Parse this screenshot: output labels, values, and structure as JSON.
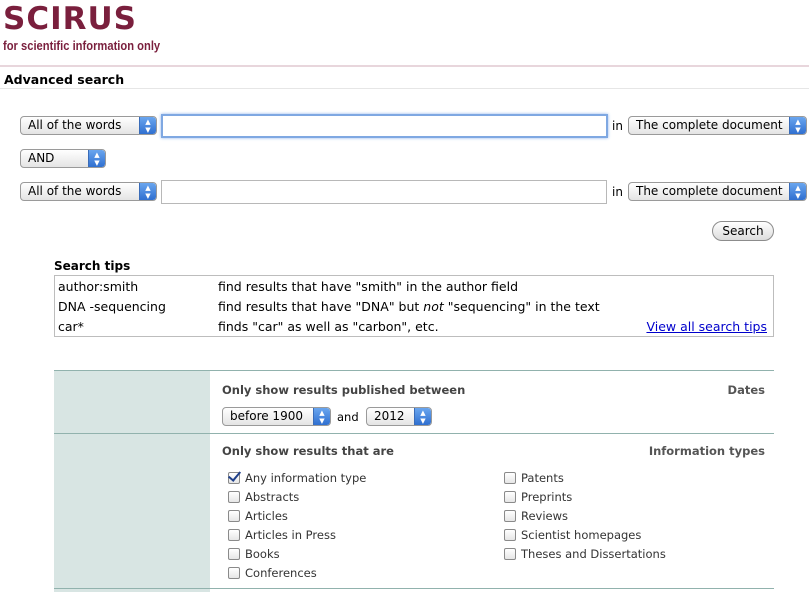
{
  "header": {
    "logo_text": "SCIRUS",
    "tagline": "for scientific information only",
    "page_title": "Advanced search"
  },
  "search": {
    "row1": {
      "match": "All of the words",
      "query": "",
      "in_label": "in",
      "scope": "The complete document"
    },
    "operator": "AND",
    "row2": {
      "match": "All of the words",
      "query": "",
      "in_label": "in",
      "scope": "The complete document"
    },
    "search_button": "Search"
  },
  "tips": {
    "title": "Search tips",
    "rows": [
      {
        "query": "author:smith",
        "desc": "find results that have \"smith\" in the author field"
      },
      {
        "query": "DNA -sequencing",
        "desc_pre": "find results that have \"DNA\" but ",
        "desc_em": "not",
        "desc_post": " \"sequencing\" in the text"
      },
      {
        "query": "car*",
        "desc": "finds \"car\" as well as \"carbon\", etc."
      }
    ],
    "view_all_link": "View all search tips"
  },
  "filters": {
    "dates": {
      "label": "Dates",
      "heading": "Only show results published between",
      "from": "before 1900",
      "and_label": "and",
      "to": "2012"
    },
    "info_types": {
      "label": "Information types",
      "heading": "Only show results that are",
      "col1": [
        {
          "label": "Any information type",
          "checked": true
        },
        {
          "label": "Abstracts",
          "checked": false
        },
        {
          "label": "Articles",
          "checked": false
        },
        {
          "label": "Articles in Press",
          "checked": false
        },
        {
          "label": "Books",
          "checked": false
        },
        {
          "label": "Conferences",
          "checked": false
        }
      ],
      "col2": [
        {
          "label": "Patents",
          "checked": false
        },
        {
          "label": "Preprints",
          "checked": false
        },
        {
          "label": "Reviews",
          "checked": false
        },
        {
          "label": "Scientist homepages",
          "checked": false
        },
        {
          "label": "Theses and Dissertations",
          "checked": false
        }
      ]
    }
  },
  "colors": {
    "brand": "#7a1f3d",
    "filter_label_bg": "#d8e5e3",
    "link": "#0000cc",
    "select_arrow": "#2f6fd0"
  }
}
